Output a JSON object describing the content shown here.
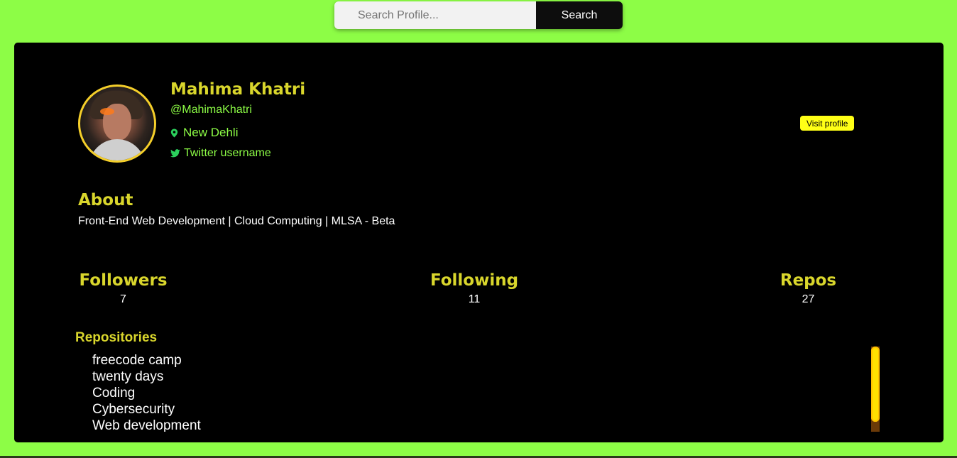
{
  "search": {
    "placeholder": "Search Profile...",
    "button_label": "Search"
  },
  "profile": {
    "name": "Mahima Khatri",
    "handle": "@MahimaKhatri",
    "location": "New Dehli",
    "twitter": "Twitter username",
    "visit_label": "Visit profile"
  },
  "about": {
    "title": "About",
    "text": "Front-End Web Development | Cloud Computing | MLSA - Beta"
  },
  "stats": {
    "followers": {
      "label": "Followers",
      "value": "7"
    },
    "following": {
      "label": "Following",
      "value": "11"
    },
    "repos": {
      "label": "Repos",
      "value": "27"
    }
  },
  "repositories": {
    "title": "Repositories",
    "items": [
      "freecode camp",
      "twenty days",
      "Coding",
      "Cybersecurity",
      "Web development"
    ]
  },
  "colors": {
    "page_background": "#8dfd46",
    "card_background": "#000000",
    "heading": "#d9d62c",
    "accent_green": "#8dfd46",
    "button_yellow": "#ffff16"
  },
  "icons": {
    "location": "map-pin-icon",
    "twitter": "twitter-bird-icon"
  }
}
